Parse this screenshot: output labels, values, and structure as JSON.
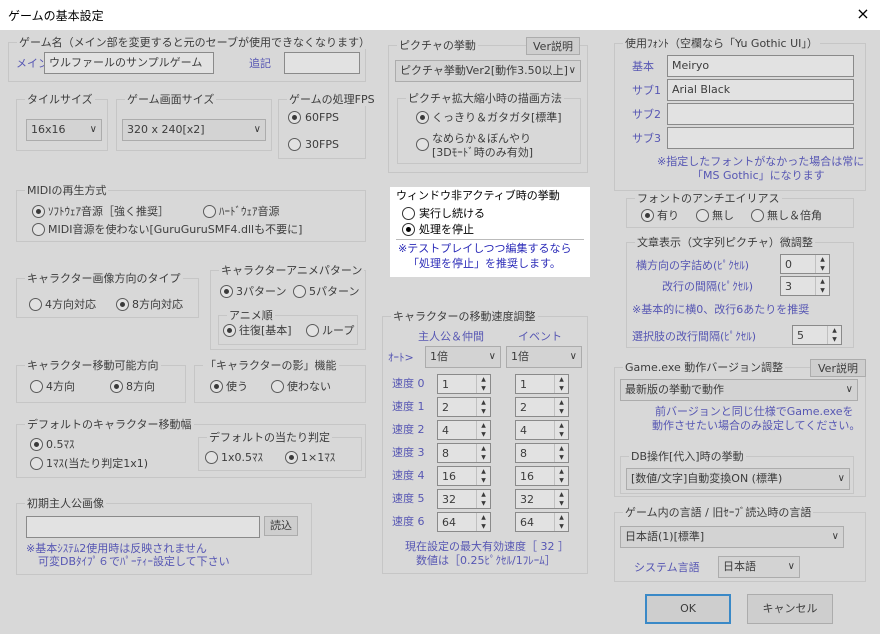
{
  "window": {
    "title": "ゲームの基本設定",
    "close": "×"
  },
  "game_name": {
    "label": "ゲーム名（メイン部を変更すると元のセーブが使用できなくなります）",
    "main_label": "メイン",
    "main_value": "ウルファールのサンプルゲーム",
    "extra_label": "追記",
    "extra_value": ""
  },
  "tile_size": {
    "label": "タイルサイズ",
    "value": "16x16"
  },
  "screen_size": {
    "label": "ゲーム画面サイズ",
    "value": "320 x 240[x2]"
  },
  "fps": {
    "label": "ゲームの処理FPS",
    "options": [
      "60FPS",
      "30FPS"
    ],
    "selected": "60FPS"
  },
  "midi": {
    "label": "MIDIの再生方式",
    "options": [
      "ｿﾌﾄｳｪｱ音源［強く推奨］",
      "ﾊｰﾄﾞｳｪｱ音源",
      "MIDI音源を使わない[GuruGuruSMF4.dllも不要に]"
    ],
    "selected": "ｿﾌﾄｳｪｱ音源［強く推奨］"
  },
  "char_dir_type": {
    "label": "キャラクター画像方向のタイプ",
    "options": [
      "4方向対応",
      "8方向対応"
    ],
    "selected": "8方向対応"
  },
  "char_anim": {
    "label": "キャラクターアニメパターン",
    "options": [
      "3パターン",
      "5パターン"
    ],
    "selected": "3パターン",
    "order_label": "アニメ順",
    "order_options": [
      "往復[基本]",
      "ループ"
    ],
    "order_selected": "往復[基本]"
  },
  "char_move_dir": {
    "label": "キャラクター移動可能方向",
    "options": [
      "4方向",
      "8方向"
    ],
    "selected": "8方向"
  },
  "char_shadow": {
    "label": "「キャラクターの影」機能",
    "options": [
      "使う",
      "使わない"
    ],
    "selected": "使う"
  },
  "char_width": {
    "label": "デフォルトのキャラクター移動幅",
    "options": [
      "0.5ﾏｽ",
      "1ﾏｽ(当たり判定1x1)"
    ],
    "selected": "0.5ﾏｽ",
    "hit_label": "デフォルトの当たり判定",
    "hit_options": [
      "1x0.5ﾏｽ",
      "1×1ﾏｽ"
    ],
    "hit_selected": "1×1ﾏｽ"
  },
  "initial_hero": {
    "label": "初期主人公画像",
    "value": "",
    "load_button": "読込",
    "note1": "※基本ｼｽﾃﾑ2使用時は反映されません",
    "note2": "可変DBﾀｲﾌﾟ６でﾊﾟｰﾃｨｰ設定して下さい"
  },
  "picture_behavior": {
    "label": "ピクチャの挙動",
    "ver_button": "Ver説明",
    "value": "ピクチャ挙動Ver2[動作3.50以上]"
  },
  "picture_scale": {
    "label": "ピクチャ拡大縮小時の描画方法",
    "options": [
      "くっきり＆ガタガタ[標準]",
      "なめらか＆ぼんやり"
    ],
    "option2_line2": "[3Dﾓｰﾄﾞ時のみ有効]",
    "selected": "くっきり＆ガタガタ[標準]"
  },
  "inactive": {
    "label": "ウィンドウ非アクティブ時の挙動",
    "options": [
      "実行し続ける",
      "処理を停止"
    ],
    "selected": "処理を停止",
    "note1": "※テストプレイしつつ編集するなら",
    "note2": "「処理を停止」を推奨します。"
  },
  "move_speed": {
    "label": "キャラクターの移動速度調整",
    "col_hero": "主人公＆仲間",
    "col_event": "イベント",
    "auto_label": "ｵｰﾄ>",
    "auto_hero": "1倍",
    "auto_event": "1倍",
    "rows": [
      {
        "label": "速度 0",
        "hero": "1",
        "event": "1"
      },
      {
        "label": "速度 1",
        "hero": "2",
        "event": "2"
      },
      {
        "label": "速度 2",
        "hero": "4",
        "event": "4"
      },
      {
        "label": "速度 3",
        "hero": "8",
        "event": "8"
      },
      {
        "label": "速度 4",
        "hero": "16",
        "event": "16"
      },
      {
        "label": "速度 5",
        "hero": "32",
        "event": "32"
      },
      {
        "label": "速度 6",
        "hero": "64",
        "event": "64"
      }
    ],
    "note1": "現在設定の最大有効速度［ 32 ］",
    "note2": "数値は［0.25ﾋﾟｸｾﾙ/1ﾌﾚｰﾑ］"
  },
  "fonts": {
    "label": "使用ﾌｫﾝﾄ（空欄なら「Yu Gothic UI」）",
    "rows": [
      {
        "label": "基本",
        "value": "Meiryo"
      },
      {
        "label": "サブ1",
        "value": "Arial Black"
      },
      {
        "label": "サブ2",
        "value": ""
      },
      {
        "label": "サブ3",
        "value": ""
      }
    ],
    "note1": "※指定したフォントがなかった場合は常に",
    "note2": "「MS Gothic」になります"
  },
  "antialias": {
    "label": "フォントのアンチエイリアス",
    "options": [
      "有り",
      "無し",
      "無し＆倍角"
    ],
    "selected": "有り"
  },
  "text_display": {
    "label": "文章表示（文字列ピクチャ）微調整",
    "spacing_label": "横方向の字詰め(ﾋﾟｸｾﾙ)",
    "spacing_value": "0",
    "line_label": "改行の間隔(ﾋﾟｸｾﾙ)",
    "line_value": "3",
    "note": "※基本的に横0、改行6あたりを推奨",
    "choice_label": "選択肢の改行間隔(ﾋﾟｸｾﾙ)",
    "choice_value": "5"
  },
  "exe_version": {
    "label": "Game.exe 動作バージョン調整",
    "ver_button": "Ver説明",
    "value": "最新版の挙動で動作",
    "note1": "前バージョンと同じ仕様でGame.exeを",
    "note2": "動作させたい場合のみ設定してください。"
  },
  "db_op": {
    "label": "DB操作[代入]時の挙動",
    "value": "[数値/文字]自動変換ON (標準)"
  },
  "language": {
    "label": "ゲーム内の言語 / 旧ｾｰﾌﾞ読込時の言語",
    "value": "日本語(1)[標準]",
    "sys_label": "システム言語",
    "sys_value": "日本語"
  },
  "buttons": {
    "ok": "OK",
    "cancel": "キャンセル"
  }
}
